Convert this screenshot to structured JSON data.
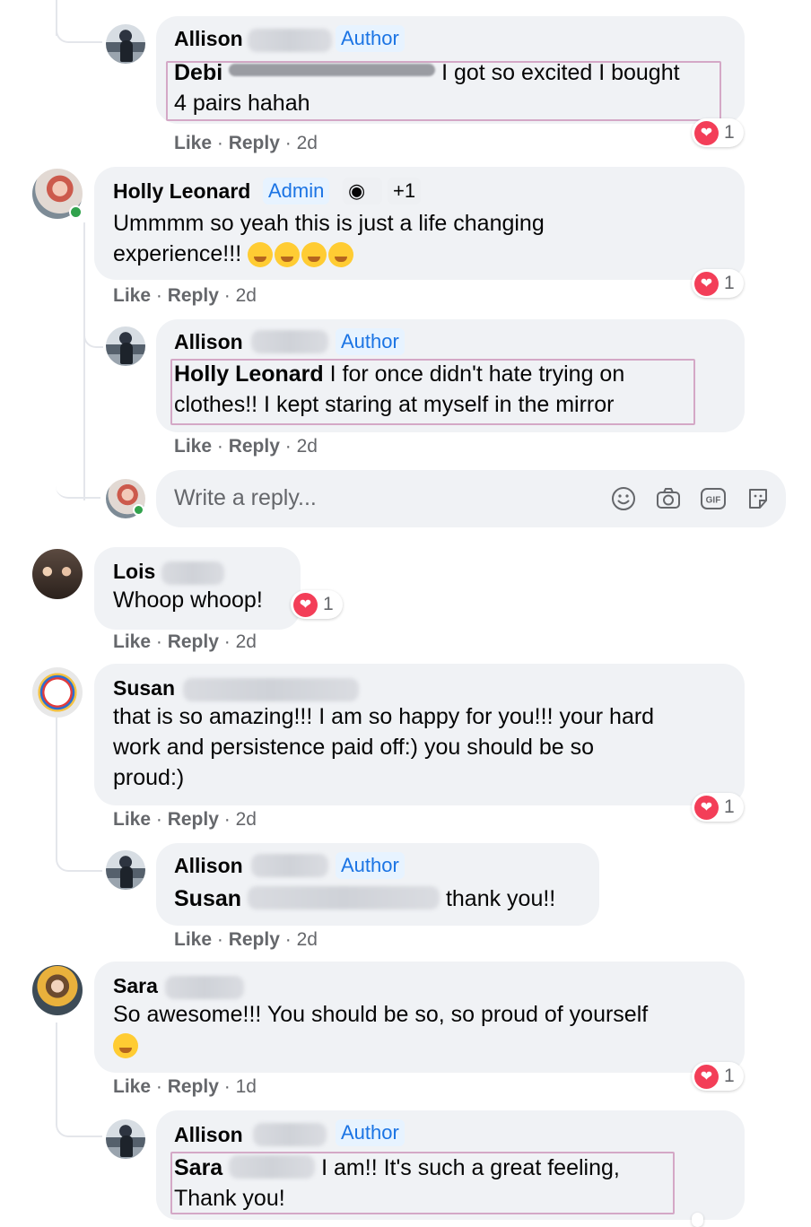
{
  "comments": [
    {
      "name": "Allison",
      "badge": "Author",
      "mention": "Debi",
      "text": "I got so excited I bought",
      "text2": "4 pairs hahah",
      "like": "Like",
      "reply": "Reply",
      "time": "2d",
      "reactions": "1"
    },
    {
      "name": "Holly Leonard",
      "badge": "Admin",
      "badge_extra": "+1",
      "text": "Ummmm so yeah this is just a life changing",
      "text2": "experience!!!",
      "like": "Like",
      "reply": "Reply",
      "time": "2d",
      "reactions": "1"
    },
    {
      "name": "Allison",
      "badge": "Author",
      "mention": "Holly Leonard",
      "text": "I for once didn't hate trying on",
      "text2": "clothes!! I kept staring at myself in the mirror",
      "like": "Like",
      "reply": "Reply",
      "time": "2d"
    },
    {
      "name": "Lois",
      "text": "Whoop whoop!",
      "like": "Like",
      "reply": "Reply",
      "time": "2d",
      "reactions": "1"
    },
    {
      "name": "Susan",
      "text": "that is so amazing!!! I am so happy for you!!! your hard",
      "text2": "work and persistence paid off:) you should be so",
      "text3": "proud:)",
      "like": "Like",
      "reply": "Reply",
      "time": "2d",
      "reactions": "1"
    },
    {
      "name": "Allison",
      "badge": "Author",
      "mention": "Susan",
      "text": "thank you!!",
      "like": "Like",
      "reply": "Reply",
      "time": "2d"
    },
    {
      "name": "Sara",
      "text": "So awesome!!! You should be so, so proud of yourself",
      "like": "Like",
      "reply": "Reply",
      "time": "1d",
      "reactions": "1"
    },
    {
      "name": "Allison",
      "badge": "Author",
      "mention": "Sara",
      "text": "I am!! It's such a great feeling,",
      "text2": "Thank you!"
    }
  ],
  "reply_input": {
    "placeholder": "Write a reply..."
  },
  "icons": [
    "smile-icon",
    "camera-icon",
    "gif-icon",
    "sticker-icon",
    "heart-reaction-icon"
  ],
  "colors": {
    "badge_text": "#1b74e4",
    "badge_bg": "#e7f3ff",
    "bubble": "#f0f2f5",
    "meta": "#65676b",
    "highlight": "#d4a8c6",
    "heart": "#f33e58"
  }
}
